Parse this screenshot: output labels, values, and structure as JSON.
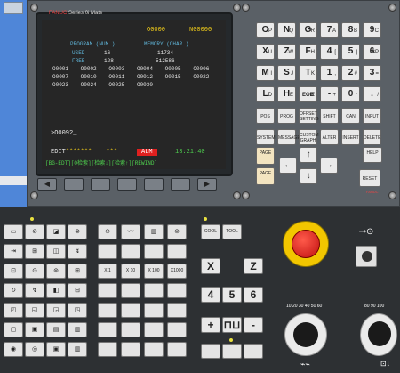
{
  "brand": {
    "maker": "FANUC",
    "series": "Series 0i Mate"
  },
  "screen": {
    "top_left": "O0000",
    "top_right": "N00000",
    "program_header": "PROGRAM (NUM.)",
    "memory_header": "MEMORY (CHAR.)",
    "used_label": "USED",
    "used_num": "16",
    "used_mem": "11734",
    "free_label": "FREE",
    "free_num": "128",
    "free_mem": "512586",
    "programs": [
      "O0001",
      "O0002",
      "O0003",
      "O0004",
      "O0005",
      "O0006",
      "O0007",
      "O0010",
      "O0011",
      "O0012",
      "O0015",
      "O0022",
      "O0023",
      "O0024",
      "O0025",
      "O0030"
    ],
    "input_line": ">O0092_",
    "mode": "EDIT",
    "stars": "*******",
    "stars2": "***",
    "alarm": "ALM",
    "time": "13:21:40",
    "softkeys": "[BG-EDT][O检索][检索↓][检索↑][REWIND]"
  },
  "softkey_buttons": [
    "◀",
    "",
    "",
    "",
    "",
    "",
    "▶"
  ],
  "keypad": {
    "letters": [
      {
        "main": "O",
        "sub": "P"
      },
      {
        "main": "N",
        "sub": "Q"
      },
      {
        "main": "G",
        "sub": "R"
      },
      {
        "main": "7",
        "sub": "A"
      },
      {
        "main": "8",
        "sub": "B"
      },
      {
        "main": "9",
        "sub": "C"
      },
      {
        "main": "X",
        "sub": "U"
      },
      {
        "main": "Z",
        "sub": "W"
      },
      {
        "main": "F",
        "sub": "H"
      },
      {
        "main": "4",
        "sub": "["
      },
      {
        "main": "5",
        "sub": "]"
      },
      {
        "main": "6",
        "sub": "SP"
      },
      {
        "main": "M",
        "sub": "I"
      },
      {
        "main": "S",
        "sub": "J"
      },
      {
        "main": "T",
        "sub": "K"
      },
      {
        "main": "1",
        "sub": ","
      },
      {
        "main": "2",
        "sub": "#"
      },
      {
        "main": "3",
        "sub": "="
      },
      {
        "main": "L",
        "sub": "D"
      },
      {
        "main": "H",
        "sub": "E"
      },
      {
        "main": "EOB",
        "sub": "E"
      },
      {
        "main": "-",
        "sub": "+"
      },
      {
        "main": "0",
        "sub": "*"
      },
      {
        "main": ".",
        "sub": "/"
      }
    ],
    "funcs": [
      "POS",
      "PROG",
      "OFFSET SETTING",
      "SHIFT",
      "CAN",
      "INPUT",
      "SYSTEM",
      "MESSAGE",
      "CUSTOM GRAPH",
      "ALTER",
      "INSERT",
      "DELETE"
    ],
    "page_up": "PAGE",
    "page_down": "PAGE",
    "help": "HELP",
    "reset": "RESET",
    "footer": "FANUC"
  },
  "lower": {
    "feed_buttons": [
      "X 1",
      "X 10",
      "X 100",
      "X1000"
    ],
    "cool": "COOL",
    "tool": "TOOL",
    "axis_x": "X",
    "axis_z": "Z",
    "num4": "4",
    "num5": "5",
    "num6": "6",
    "plus": "+",
    "minus": "-",
    "dial_left_marks": [
      "10",
      "20",
      "30",
      "40",
      "50",
      "60",
      "70",
      "80",
      "90",
      "100",
      "110",
      "120"
    ],
    "dial_right_marks": [
      "50",
      "60",
      "70",
      "80",
      "90",
      "100",
      "110",
      "120"
    ]
  }
}
